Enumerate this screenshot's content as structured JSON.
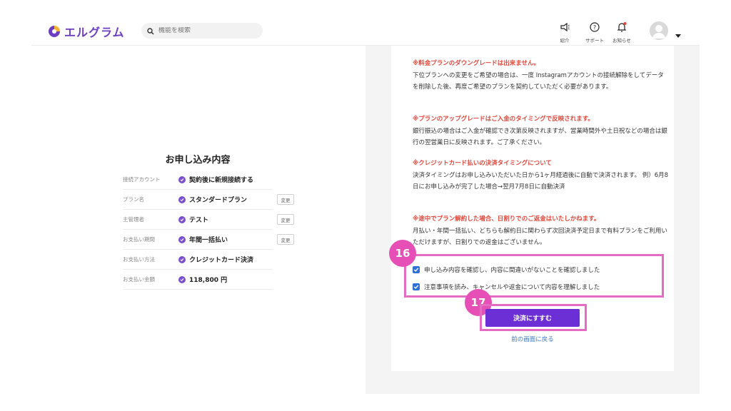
{
  "header": {
    "logo_text": "エルグラム",
    "search_placeholder": "機能を検索",
    "icons": [
      {
        "name": "megaphone-icon",
        "label": "紹介"
      },
      {
        "name": "help-icon",
        "label": "サポート"
      },
      {
        "name": "bell-icon",
        "label": "お知らせ"
      }
    ],
    "brand_color": "#6c3fc2",
    "notification_dot_color": "#e0473c"
  },
  "summary": {
    "title": "お申し込み内容",
    "rows": [
      {
        "label": "接続アカウント",
        "value": "契約後に新規接続する",
        "change": ""
      },
      {
        "label": "プラン名",
        "value": "スタンダードプラン",
        "change": "変更"
      },
      {
        "label": "主管理者",
        "value": "テスト",
        "change": "変更"
      },
      {
        "label": "お支払い期間",
        "value": "年間一括払い",
        "change": "変更"
      },
      {
        "label": "お支払い方法",
        "value": "クレジットカード決済",
        "change": ""
      },
      {
        "label": "お支払い金額",
        "value": "118,800 円",
        "change": ""
      }
    ]
  },
  "notices": [
    {
      "head": "※料金プランのダウングレードは出来ません。",
      "body": "下位プランへの変更をご希望の場合は、一度 Instagramアカウントの接続解除をしてデータを削除した後、再度ご希望のプランを契約していただく必要があります。"
    },
    {
      "head": "※プランのアップグレードはご入金のタイミングで反映されます。",
      "body": "銀行振込の場合はご入金が確認でき次第反映されますが、営業時間外や土日祝などの場合は銀行の翌営業日に反映されます。ご了承ください。"
    },
    {
      "head": "※クレジットカード払いの決済タイミングについて",
      "body": "決済タイミングはお申し込みいただいた日から1ヶ月経過後に自動で決済されます。 例）6月8日にお申し込みが完了した場合→翌月7月8日に自動決済"
    },
    {
      "head": "※途中でプラン解約した場合、日割りでのご返金はいたしかねます。",
      "body": "月払い・年間一括払い、どちらも解約日に関わらず次回決済予定日まで有料プランをご利用いただけますが、日割りでの返金はございません。"
    }
  ],
  "agreements": [
    {
      "label": "申し込み内容を確認し、内容に間違いがないことを確認しました",
      "checked": true
    },
    {
      "label": "注意事項を読み、キャンセルや返金について内容を理解しました",
      "checked": true
    }
  ],
  "badges": {
    "agree": "16",
    "pay": "17"
  },
  "actions": {
    "pay_label": "決済にすすむ",
    "back_label": "前の画面に戻る"
  },
  "colors": {
    "accent_pink": "#e46cc2",
    "primary_button": "#6c2fd6",
    "warning_red": "#e0473c",
    "link_blue": "#3a78c9"
  }
}
